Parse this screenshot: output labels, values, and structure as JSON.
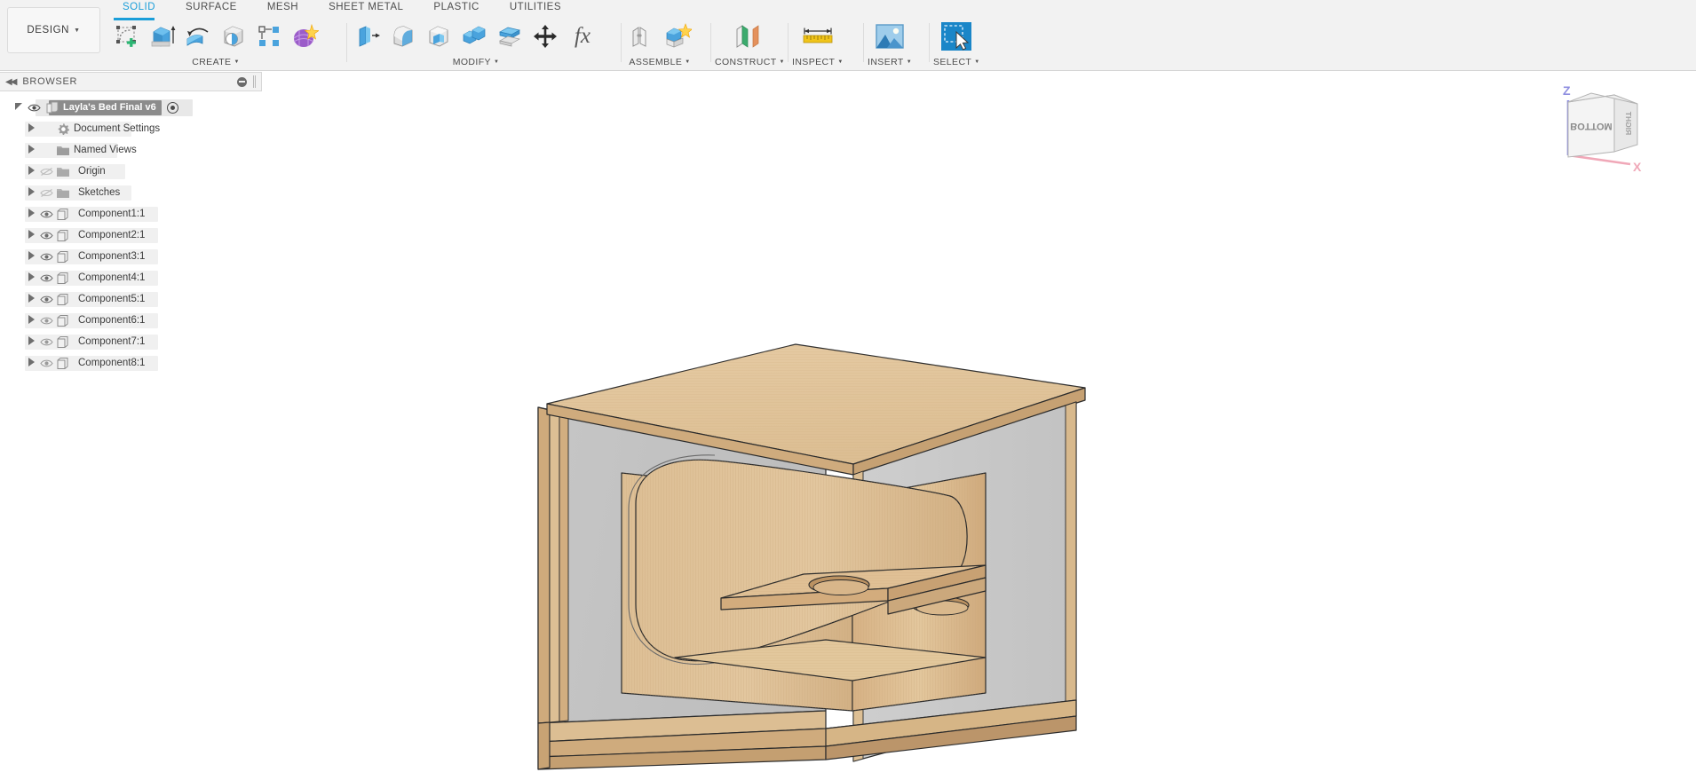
{
  "app": {
    "workspace_button": "DESIGN",
    "caret": "▾"
  },
  "ribbon": {
    "tabs": [
      {
        "label": "SOLID",
        "active": true
      },
      {
        "label": "SURFACE",
        "active": false
      },
      {
        "label": "MESH",
        "active": false
      },
      {
        "label": "SHEET METAL",
        "active": false
      },
      {
        "label": "PLASTIC",
        "active": false
      },
      {
        "label": "UTILITIES",
        "active": false
      }
    ],
    "panels": [
      {
        "label": "CREATE",
        "has_caret": true,
        "icons": [
          "create-sketch-icon",
          "extrude-icon",
          "revolve-icon",
          "sweep-icon",
          "pattern-icon",
          "form-icon"
        ]
      },
      {
        "label": "MODIFY",
        "has_caret": true,
        "icons": [
          "press-pull-icon",
          "fillet-icon",
          "shell-icon",
          "combine-icon",
          "offset-face-icon",
          "move-copy-icon",
          "change-parameters-icon"
        ]
      },
      {
        "label": "ASSEMBLE",
        "has_caret": true,
        "icons": [
          "new-component-icon",
          "joint-icon"
        ]
      },
      {
        "label": "CONSTRUCT",
        "has_caret": true,
        "icons": [
          "offset-plane-icon"
        ]
      },
      {
        "label": "INSPECT",
        "has_caret": true,
        "icons": [
          "measure-icon"
        ]
      },
      {
        "label": "INSERT",
        "has_caret": true,
        "icons": [
          "insert-image-icon"
        ]
      },
      {
        "label": "SELECT",
        "has_caret": true,
        "icons": [
          "select-window-icon"
        ]
      }
    ]
  },
  "browser": {
    "title": "BROWSER",
    "collapse_icon": "collapse-left-icon",
    "minimize_icon": "minimize-icon",
    "tree": [
      {
        "label": "Layla's Bed Final v6",
        "icon": "document-icon",
        "eye": "visible",
        "arrow": "expanded",
        "indent": 0,
        "root": true,
        "radio": true
      },
      {
        "label": "Document Settings",
        "icon": "gear-icon",
        "eye": "none",
        "arrow": "collapsed",
        "indent": 1
      },
      {
        "label": "Named Views",
        "icon": "folder-icon",
        "eye": "none",
        "arrow": "collapsed",
        "indent": 1
      },
      {
        "label": "Origin",
        "icon": "folder-icon",
        "eye": "hidden",
        "arrow": "collapsed",
        "indent": 1
      },
      {
        "label": "Sketches",
        "icon": "folder-icon",
        "eye": "hidden",
        "arrow": "collapsed",
        "indent": 1
      },
      {
        "label": "Component1:1",
        "icon": "component-icon",
        "eye": "visible",
        "arrow": "collapsed",
        "indent": 1
      },
      {
        "label": "Component2:1",
        "icon": "component-icon",
        "eye": "visible",
        "arrow": "collapsed",
        "indent": 1
      },
      {
        "label": "Component3:1",
        "icon": "component-icon",
        "eye": "visible",
        "arrow": "collapsed",
        "indent": 1
      },
      {
        "label": "Component4:1",
        "icon": "component-icon",
        "eye": "visible",
        "arrow": "collapsed",
        "indent": 1
      },
      {
        "label": "Component5:1",
        "icon": "component-icon",
        "eye": "visible",
        "arrow": "collapsed",
        "indent": 1
      },
      {
        "label": "Component6:1",
        "icon": "component-icon",
        "eye": "visible",
        "arrow": "collapsed",
        "indent": 1
      },
      {
        "label": "Component7:1",
        "icon": "component-icon",
        "eye": "visible",
        "arrow": "collapsed",
        "indent": 1
      },
      {
        "label": "Component8:1",
        "icon": "component-icon",
        "eye": "visible",
        "arrow": "collapsed",
        "indent": 1
      }
    ]
  },
  "viewcube": {
    "face_front": "BOTTOM",
    "face_right": "RIGHT",
    "axis_z": "Z",
    "axis_x": "X"
  },
  "model": {
    "description": "Plywood cat/dog bed box with rounded cut-out opening and interior shelf with two oval holes",
    "colors": {
      "plywood_light": "#e0c39a",
      "plywood_face": "#d9b98d",
      "plywood_edge": "#c9a678",
      "panel_grey": "#c3c3c3",
      "panel_grey_light": "#d2d2d2",
      "edge_line": "#2b2b2b",
      "accent": "#1a9ed9"
    }
  }
}
